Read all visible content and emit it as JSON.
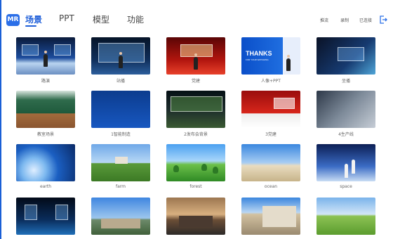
{
  "app": {
    "logo_text": "MR"
  },
  "nav": {
    "tabs": [
      {
        "label": "场景",
        "active": true
      },
      {
        "label": "PPT",
        "active": false
      },
      {
        "label": "模型",
        "active": false
      },
      {
        "label": "功能",
        "active": false
      }
    ]
  },
  "toolbar": {
    "links": [
      "推流",
      "录制",
      "已连接"
    ],
    "exit_icon": "exit-icon"
  },
  "scenes": [
    {
      "label": "路演",
      "thumb": "stage"
    },
    {
      "label": "站播",
      "thumb": "stage2"
    },
    {
      "label": "党建",
      "thumb": "party"
    },
    {
      "label": "人像+PPT",
      "thumb": "thanks",
      "overlay": "THANKS",
      "overlay_sub": "FOR YOUR WATCHING"
    },
    {
      "label": "坐播",
      "thumb": "tech"
    },
    {
      "label": "教室场景",
      "thumb": "class"
    },
    {
      "label": "1智能制造",
      "thumb": "blue"
    },
    {
      "label": "2发布会背景",
      "thumb": "launch"
    },
    {
      "label": "3党建",
      "thumb": "red2"
    },
    {
      "label": "4生产线",
      "thumb": "prod"
    },
    {
      "label": "earth",
      "thumb": "earth"
    },
    {
      "label": "farm",
      "thumb": "farm"
    },
    {
      "label": "forest",
      "thumb": "forest"
    },
    {
      "label": "ocean",
      "thumb": "ocean"
    },
    {
      "label": "space",
      "thumb": "space"
    },
    {
      "label": "",
      "thumb": "holo"
    },
    {
      "label": "",
      "thumb": "bldg1"
    },
    {
      "label": "",
      "thumb": "bldg2"
    },
    {
      "label": "",
      "thumb": "bldg3"
    },
    {
      "label": "",
      "thumb": "field"
    }
  ]
}
